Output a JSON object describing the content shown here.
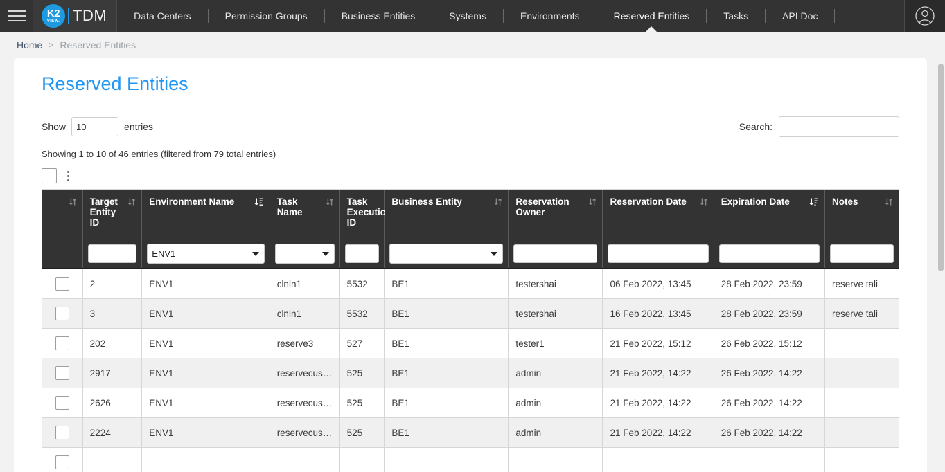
{
  "topnav": {
    "menu_icon": "hamburger-icon",
    "logo_k2": "K2",
    "logo_view": "VIEW.",
    "brand": "TDM",
    "items": [
      {
        "label": "Data Centers",
        "active": false
      },
      {
        "label": "Permission Groups",
        "active": false
      },
      {
        "label": "Business Entities",
        "active": false
      },
      {
        "label": "Systems",
        "active": false
      },
      {
        "label": "Environments",
        "active": false
      },
      {
        "label": "Reserved Entities",
        "active": true
      },
      {
        "label": "Tasks",
        "active": false
      },
      {
        "label": "API Doc",
        "active": false
      }
    ],
    "avatar_icon": "user-avatar-icon"
  },
  "breadcrumb": {
    "home": "Home",
    "separator": ">",
    "current": "Reserved Entities"
  },
  "page": {
    "title": "Reserved Entities",
    "accent_color": "#2196f3"
  },
  "controls": {
    "show_label": "Show",
    "entries_value": "10",
    "entries_label": "entries",
    "search_label": "Search:",
    "search_value": "",
    "search_placeholder": "",
    "showing_info": "Showing 1 to 10 of 46 entries (filtered from 79 total entries)"
  },
  "toolbar": {
    "select_all_icon": "checkbox-icon",
    "menu_icon": "kebab-menu-icon"
  },
  "table": {
    "columns": [
      {
        "label": "",
        "sort": "none",
        "key": "select"
      },
      {
        "label": "Target Entity ID",
        "sort": "none"
      },
      {
        "label": "Environment Name",
        "sort": "asc"
      },
      {
        "label": "Task Name",
        "sort": "none"
      },
      {
        "label": "Task Execution ID",
        "sort": "desc"
      },
      {
        "label": "Business Entity",
        "sort": "none"
      },
      {
        "label": "Reservation Owner",
        "sort": "none"
      },
      {
        "label": "Reservation Date",
        "sort": "none"
      },
      {
        "label": "Expiration Date",
        "sort": "desc"
      },
      {
        "label": "Notes",
        "sort": "none"
      }
    ],
    "filters": [
      {
        "type": "none",
        "value": ""
      },
      {
        "type": "text",
        "value": ""
      },
      {
        "type": "select",
        "value": "ENV1"
      },
      {
        "type": "select",
        "value": ""
      },
      {
        "type": "text",
        "value": ""
      },
      {
        "type": "select",
        "value": ""
      },
      {
        "type": "text",
        "value": ""
      },
      {
        "type": "text",
        "value": ""
      },
      {
        "type": "text",
        "value": ""
      },
      {
        "type": "text",
        "value": ""
      }
    ],
    "rows": [
      {
        "target_entity_id": "2",
        "environment_name": "ENV1",
        "task_name": "clnln1",
        "task_execution_id": "5532",
        "business_entity": "BE1",
        "reservation_owner": "testershai",
        "reservation_date": "06 Feb 2022, 13:45",
        "expiration_date": "28 Feb 2022, 23:59",
        "notes": "reserve tali"
      },
      {
        "target_entity_id": "3",
        "environment_name": "ENV1",
        "task_name": "clnln1",
        "task_execution_id": "5532",
        "business_entity": "BE1",
        "reservation_owner": "testershai",
        "reservation_date": "16 Feb 2022, 13:45",
        "expiration_date": "28 Feb 2022, 23:59",
        "notes": "reserve tali"
      },
      {
        "target_entity_id": "202",
        "environment_name": "ENV1",
        "task_name": "reserve3",
        "task_execution_id": "527",
        "business_entity": "BE1",
        "reservation_owner": "tester1",
        "reservation_date": "21 Feb 2022, 15:12",
        "expiration_date": "26 Feb 2022, 15:12",
        "notes": ""
      },
      {
        "target_entity_id": "2917",
        "environment_name": "ENV1",
        "task_name": "reservecustom",
        "task_execution_id": "525",
        "business_entity": "BE1",
        "reservation_owner": "admin",
        "reservation_date": "21 Feb 2022, 14:22",
        "expiration_date": "26 Feb 2022, 14:22",
        "notes": ""
      },
      {
        "target_entity_id": "2626",
        "environment_name": "ENV1",
        "task_name": "reservecustom",
        "task_execution_id": "525",
        "business_entity": "BE1",
        "reservation_owner": "admin",
        "reservation_date": "21 Feb 2022, 14:22",
        "expiration_date": "26 Feb 2022, 14:22",
        "notes": ""
      },
      {
        "target_entity_id": "2224",
        "environment_name": "ENV1",
        "task_name": "reservecustom",
        "task_execution_id": "525",
        "business_entity": "BE1",
        "reservation_owner": "admin",
        "reservation_date": "21 Feb 2022, 14:22",
        "expiration_date": "26 Feb 2022, 14:22",
        "notes": ""
      },
      {
        "target_entity_id": "",
        "environment_name": "",
        "task_name": "",
        "task_execution_id": "",
        "business_entity": "",
        "reservation_owner": "",
        "reservation_date": "",
        "expiration_date": "",
        "notes": ""
      }
    ]
  }
}
